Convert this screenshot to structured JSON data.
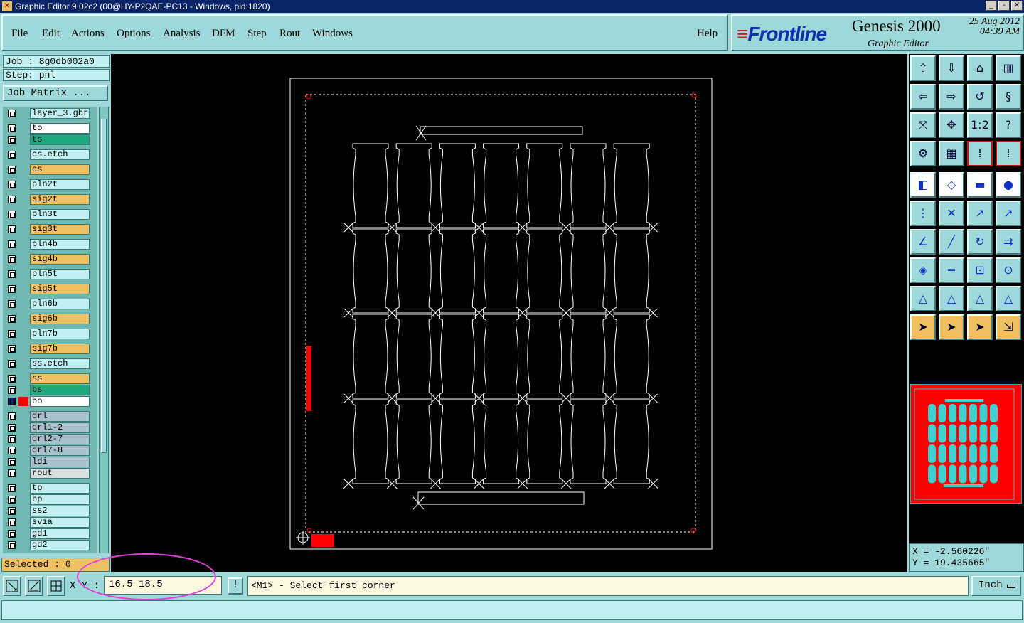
{
  "window": {
    "title": "Graphic Editor 9.02c2 (00@HY-P2QAE-PC13 - Windows, pid:1820)",
    "controls": [
      "_",
      "▫",
      "✕"
    ]
  },
  "menu": [
    {
      "label": "File"
    },
    {
      "label": "Edit"
    },
    {
      "label": "Actions"
    },
    {
      "label": "Options"
    },
    {
      "label": "Analysis"
    },
    {
      "label": "DFM"
    },
    {
      "label": "Step"
    },
    {
      "label": "Rout"
    },
    {
      "label": "Windows"
    }
  ],
  "help_label": "Help",
  "brand": {
    "logo_mark": "≡",
    "logo": "Frontline",
    "product": "Genesis 2000",
    "subtitle": "Graphic Editor",
    "date": "25 Aug 2012",
    "time": "04:39 AM"
  },
  "job": {
    "job_line": "Job : 8g0db002a0",
    "step_line": "Step: pnl",
    "job_matrix": "Job Matrix ..."
  },
  "layers": [
    {
      "name": "layer_3.gbr",
      "color": "#c0f0f0"
    },
    {
      "name": "to",
      "color": "#ffffff"
    },
    {
      "name": "ts",
      "color": "#20a880"
    },
    {
      "name": "cs.etch",
      "color": "#c0f0f0"
    },
    {
      "name": "cs",
      "color": "#f0c060"
    },
    {
      "name": "pln2t",
      "color": "#c0f0f0"
    },
    {
      "name": "sig2t",
      "color": "#f0c060"
    },
    {
      "name": "pln3t",
      "color": "#c0f0f0"
    },
    {
      "name": "sig3t",
      "color": "#f0c060"
    },
    {
      "name": "pln4b",
      "color": "#c0f0f0"
    },
    {
      "name": "sig4b",
      "color": "#f0c060"
    },
    {
      "name": "pln5t",
      "color": "#c0f0f0"
    },
    {
      "name": "sig5t",
      "color": "#f0c060"
    },
    {
      "name": "pln6b",
      "color": "#c0f0f0"
    },
    {
      "name": "sig6b",
      "color": "#f0c060"
    },
    {
      "name": "pln7b",
      "color": "#c0f0f0"
    },
    {
      "name": "sig7b",
      "color": "#f0c060"
    },
    {
      "name": "ss.etch",
      "color": "#c0f0f0"
    },
    {
      "name": "ss",
      "color": "#f0c060"
    },
    {
      "name": "bs",
      "color": "#20a880"
    },
    {
      "name": "bo",
      "color": "#ffffff",
      "active": true,
      "display_color": "#ff0000"
    },
    {
      "name": "drl",
      "color": "#a8c0c8"
    },
    {
      "name": "drl1-2",
      "color": "#a8c0c8"
    },
    {
      "name": "drl2-7",
      "color": "#a8c0c8"
    },
    {
      "name": "drl7-8",
      "color": "#a8c0c8"
    },
    {
      "name": "ldi",
      "color": "#a8c0c8"
    },
    {
      "name": "rout",
      "color": "#d8e0e0"
    },
    {
      "name": "tp",
      "color": "#c0f0f0"
    },
    {
      "name": "bp",
      "color": "#c0f0f0"
    },
    {
      "name": "ss2",
      "color": "#c0f0f0"
    },
    {
      "name": "svia",
      "color": "#c0f0f0"
    },
    {
      "name": "gd1",
      "color": "#c0f0f0"
    },
    {
      "name": "gd2",
      "color": "#c0f0f0"
    }
  ],
  "selected_label": "Selected : 0",
  "coords": {
    "x_line": "X = -2.560226\"",
    "y_line": "Y = 19.435665\""
  },
  "bottom": {
    "xy_label": "X Y :",
    "xy_value": "16.5 18.5",
    "excl": "!",
    "prompt": "<M1> - Select first corner",
    "units": "Inch"
  },
  "toolbar_icons": [
    "open-job-icon",
    "save-icon",
    "home-icon",
    "panel-icon",
    "back-icon",
    "forward-icon",
    "flip-icon",
    "rotate-icon",
    "zoom-fit-icon",
    "zoom-center-icon",
    "zoom-1-2-icon",
    "help-icon",
    "tools-icon",
    "grid-icon",
    "snap-icon",
    "snap2-icon",
    "fill-icon",
    "erase-icon",
    "ruler-icon",
    "pad-icon",
    "nodes-icon",
    "delete-icon",
    "move-icon",
    "copy-icon",
    "angle-icon",
    "line-icon",
    "arc-icon",
    "text-icon",
    "add-pad-icon",
    "line-h-icon",
    "measure-icon",
    "shapes-icon",
    "triangle-icon",
    "triangle2-icon",
    "triangle3-icon",
    "triangle4-icon",
    "select-icon",
    "select-box-icon",
    "select-pointer-icon",
    "select-net-icon"
  ]
}
